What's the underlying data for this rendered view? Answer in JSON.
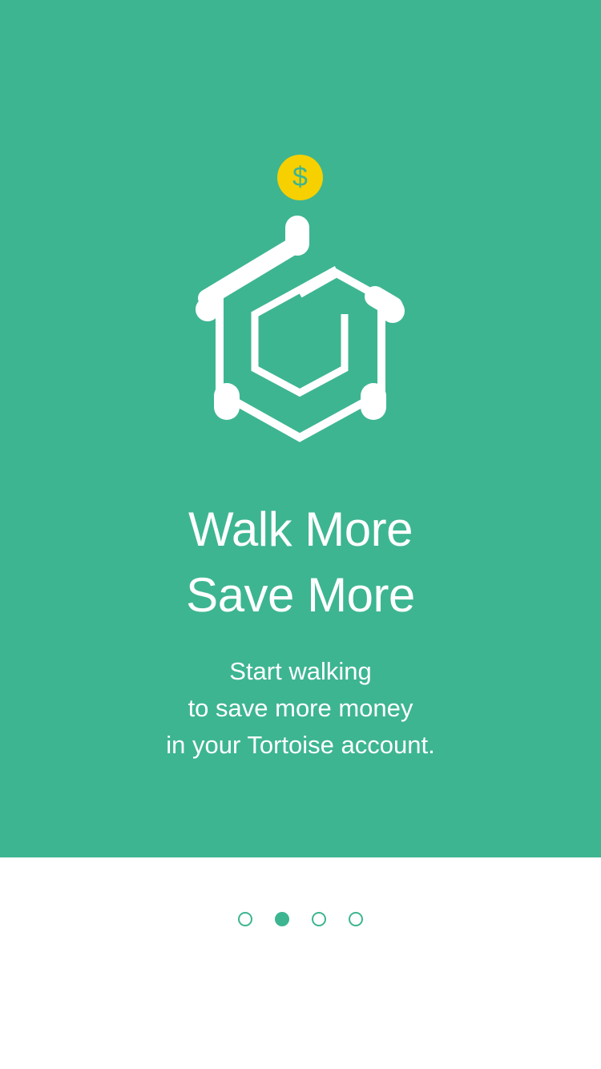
{
  "onboarding": {
    "coin_symbol": "$",
    "headline_line1": "Walk More",
    "headline_line2": "Save More",
    "body_line1": "Start walking",
    "body_line2": "to save more money",
    "body_line3": "in your Tortoise account.",
    "page_indicator": {
      "total": 4,
      "active_index": 1
    }
  },
  "colors": {
    "brand_green": "#3db591",
    "coin_yellow": "#f7d000",
    "text_white": "#ffffff",
    "background": "#ffffff"
  },
  "icons": {
    "coin": "dollar-coin-icon",
    "logo": "tortoise-house-logo-icon"
  }
}
